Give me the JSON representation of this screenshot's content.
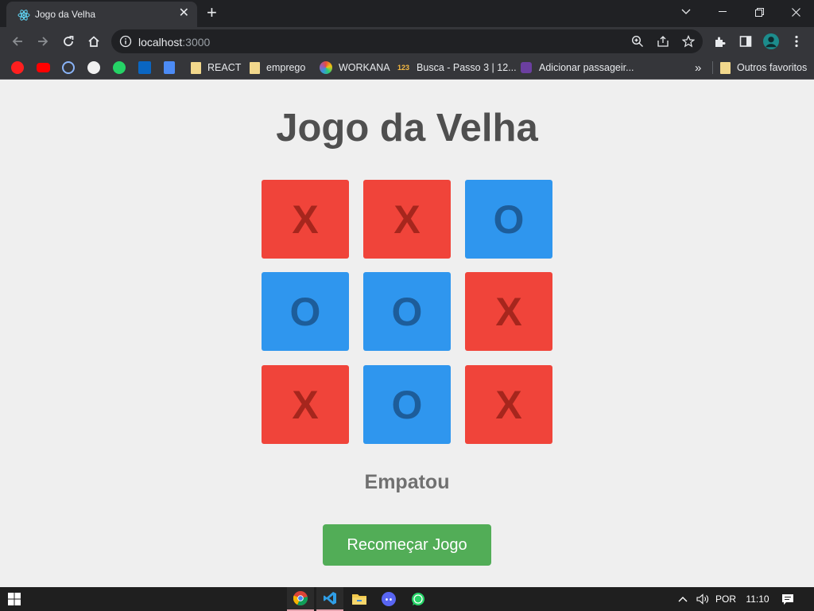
{
  "browser": {
    "tab_title": "Jogo da Velha",
    "url_host": "localhost",
    "url_port": ":3000"
  },
  "bookmarks": {
    "items": [
      "REACT",
      "emprego",
      "WORKANA",
      "Busca - Passo 3 | 12...",
      "Adicionar passageir..."
    ],
    "overflow": "»",
    "other_favorites": "Outros favoritos"
  },
  "game": {
    "title": "Jogo da Velha",
    "board": [
      "X",
      "X",
      "O",
      "O",
      "O",
      "X",
      "X",
      "O",
      "X"
    ],
    "status": "Empatou",
    "restart_label": "Recomeçar Jogo"
  },
  "taskbar": {
    "language": "POR",
    "time": "11:10"
  },
  "colors": {
    "x_cell": "#f0443a",
    "o_cell": "#2f96ee",
    "restart_button": "#52ad57",
    "title": "#4f4f4f"
  }
}
